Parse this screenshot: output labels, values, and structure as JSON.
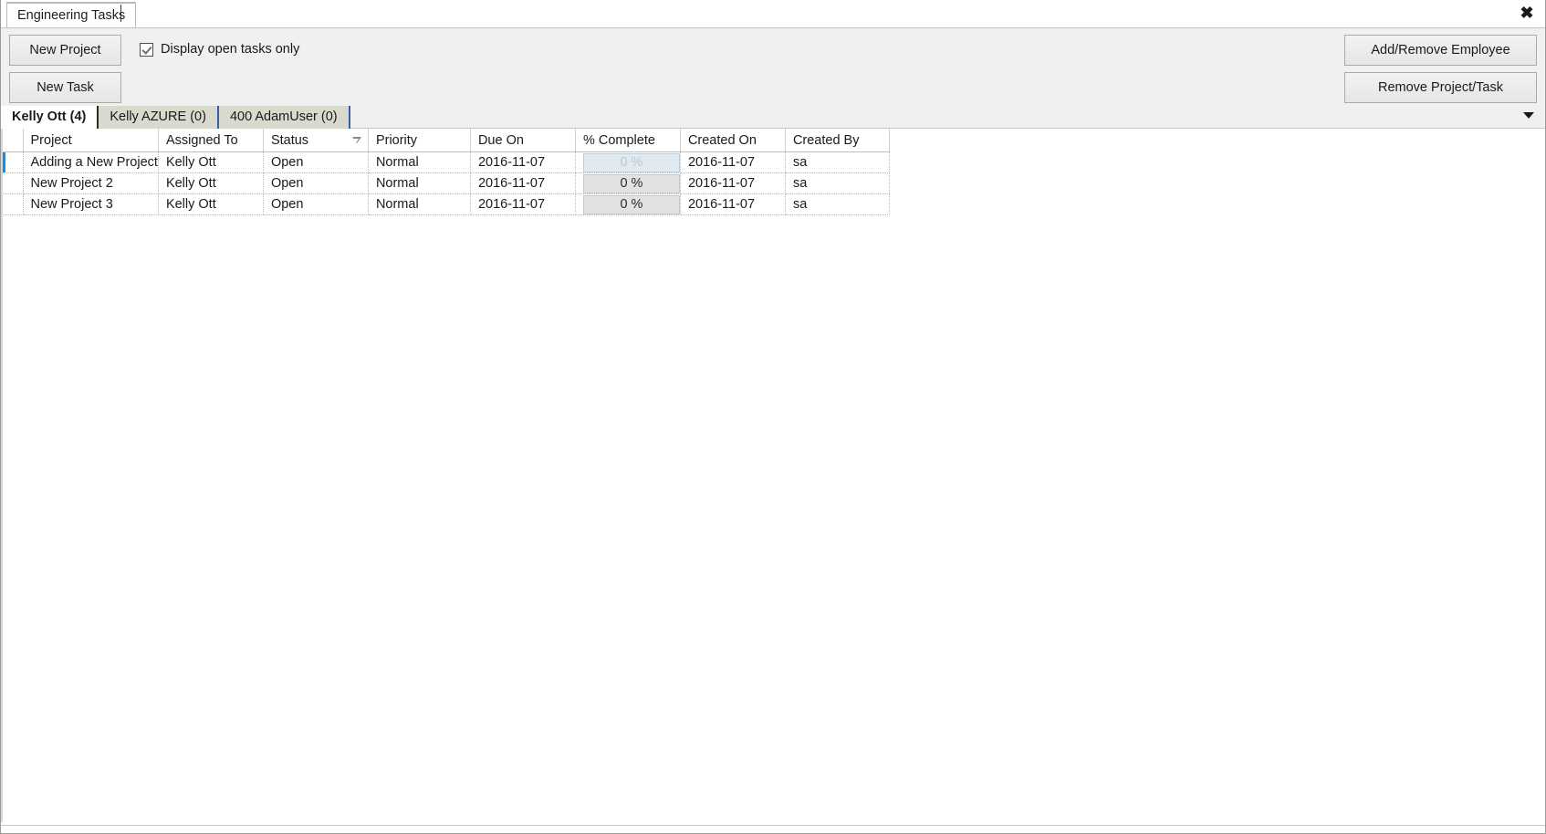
{
  "window": {
    "document_tab_label": "Engineering Tasks",
    "close_icon": "close-icon",
    "close_glyph": "✖"
  },
  "toolbar": {
    "new_project_label": "New Project",
    "new_task_label": "New Task",
    "add_remove_employee_label": "Add/Remove Employee",
    "remove_project_task_label": "Remove Project/Task",
    "display_open_tasks_label": "Display open tasks only",
    "display_open_tasks_checked": true
  },
  "employee_tabs": {
    "items": [
      {
        "label": "Kelly Ott (4)",
        "active": true
      },
      {
        "label": "Kelly AZURE (0)",
        "active": false
      },
      {
        "label": "400 AdamUser (0)",
        "active": false
      }
    ],
    "overflow_icon": "chevron-down-icon"
  },
  "grid": {
    "columns": [
      {
        "key": "project",
        "label": "Project",
        "sorted": false
      },
      {
        "key": "assigned_to",
        "label": "Assigned To",
        "sorted": false
      },
      {
        "key": "status",
        "label": "Status",
        "sorted": true,
        "sort_direction": "descending"
      },
      {
        "key": "priority",
        "label": "Priority",
        "sorted": false
      },
      {
        "key": "due_on",
        "label": "Due On",
        "sorted": false
      },
      {
        "key": "pct_complete",
        "label": "% Complete",
        "sorted": false
      },
      {
        "key": "created_on",
        "label": "Created On",
        "sorted": false
      },
      {
        "key": "created_by",
        "label": "Created By",
        "sorted": false
      }
    ],
    "rows": [
      {
        "selected": true,
        "project": "Adding a New Project",
        "assigned_to": "Kelly Ott",
        "status": "Open",
        "priority": "Normal",
        "due_on": "2016-11-07",
        "due_overdue": false,
        "pct_complete": "0 %",
        "created_on": "2016-11-07",
        "created_by": "sa"
      },
      {
        "selected": false,
        "project": "New Project 2",
        "assigned_to": "Kelly Ott",
        "status": "Open",
        "priority": "Normal",
        "due_on": "2016-11-07",
        "due_overdue": true,
        "pct_complete": "0 %",
        "created_on": "2016-11-07",
        "created_by": "sa"
      },
      {
        "selected": false,
        "project": "New Project 3",
        "assigned_to": "Kelly Ott",
        "status": "Open",
        "priority": "Normal",
        "due_on": "2016-11-07",
        "due_overdue": true,
        "pct_complete": "0 %",
        "created_on": "2016-11-07",
        "created_by": "sa"
      }
    ]
  },
  "colors": {
    "selection_blue": "#1e8ae0",
    "overdue_red": "#e21b1b",
    "toolbar_gray": "#f0f0f0",
    "tab_inactive": "#d9d9ce"
  }
}
